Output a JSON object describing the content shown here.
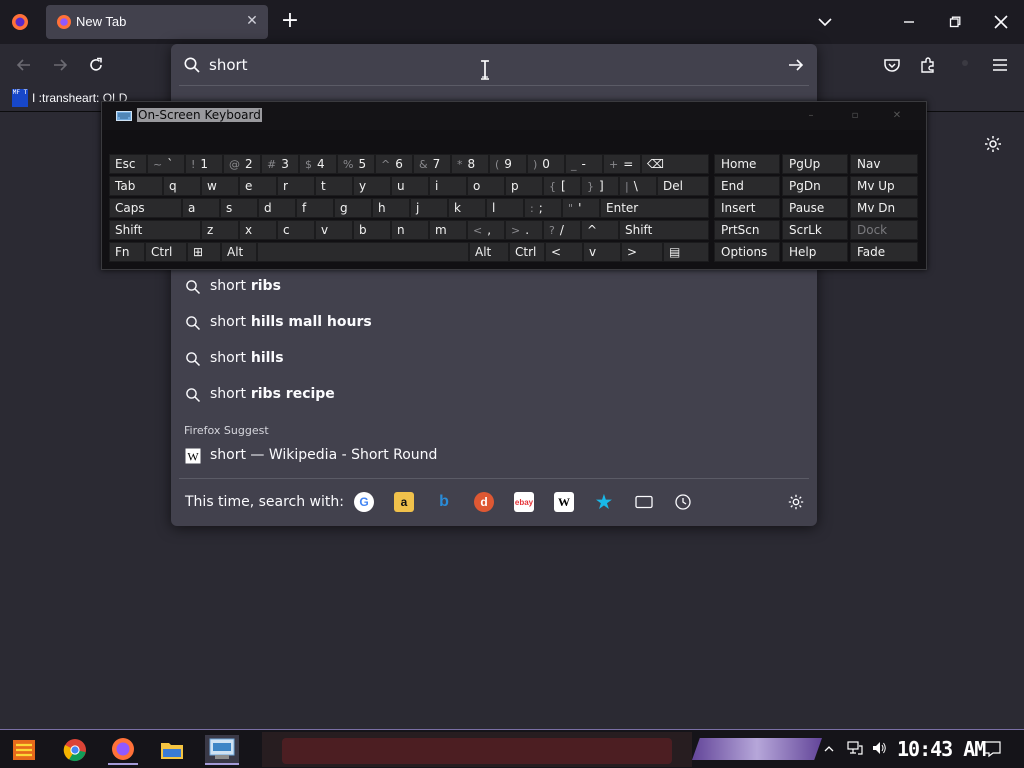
{
  "tab": {
    "title": "New Tab"
  },
  "bookmarks": {
    "item_label": "I :transheart: OLD",
    "item_icon_text": "MF T"
  },
  "urlbar": {
    "value": "short",
    "placeholder": ""
  },
  "suggestions": [
    {
      "prefix": "short",
      "bold": " ribs"
    },
    {
      "prefix": "short",
      "bold": " hills mall hours"
    },
    {
      "prefix": "short",
      "bold": " hills"
    },
    {
      "prefix": "short",
      "bold": " ribs recipe"
    }
  ],
  "firefox_suggest": {
    "header": "Firefox Suggest",
    "item": "short — Wikipedia - Short Round"
  },
  "oneoff": {
    "label": "This time, search with:",
    "engines": [
      "google",
      "amazon",
      "bing",
      "duckduckgo",
      "ebay",
      "wikipedia",
      "bookmarks",
      "tabs",
      "history"
    ]
  },
  "osk": {
    "title": "On-Screen Keyboard",
    "row1": [
      {
        "s": "",
        "m": "Esc"
      },
      {
        "s": "~",
        "m": "`"
      },
      {
        "s": "!",
        "m": "1"
      },
      {
        "s": "@",
        "m": "2"
      },
      {
        "s": "#",
        "m": "3"
      },
      {
        "s": "$",
        "m": "4"
      },
      {
        "s": "%",
        "m": "5"
      },
      {
        "s": "^",
        "m": "6"
      },
      {
        "s": "&",
        "m": "7"
      },
      {
        "s": "*",
        "m": "8"
      },
      {
        "s": "(",
        "m": "9"
      },
      {
        "s": ")",
        "m": "0"
      },
      {
        "s": "_",
        "m": "-"
      },
      {
        "s": "+",
        "m": "="
      },
      {
        "s": "",
        "m": "⌫"
      }
    ],
    "row2": [
      {
        "s": "",
        "m": "Tab"
      },
      {
        "s": "",
        "m": "q"
      },
      {
        "s": "",
        "m": "w"
      },
      {
        "s": "",
        "m": "e"
      },
      {
        "s": "",
        "m": "r"
      },
      {
        "s": "",
        "m": "t"
      },
      {
        "s": "",
        "m": "y"
      },
      {
        "s": "",
        "m": "u"
      },
      {
        "s": "",
        "m": "i"
      },
      {
        "s": "",
        "m": "o"
      },
      {
        "s": "",
        "m": "p"
      },
      {
        "s": "{",
        "m": "["
      },
      {
        "s": "}",
        "m": "]"
      },
      {
        "s": "|",
        "m": "\\"
      },
      {
        "s": "",
        "m": "Del"
      }
    ],
    "row3": [
      {
        "s": "",
        "m": "Caps"
      },
      {
        "s": "",
        "m": "a"
      },
      {
        "s": "",
        "m": "s"
      },
      {
        "s": "",
        "m": "d"
      },
      {
        "s": "",
        "m": "f"
      },
      {
        "s": "",
        "m": "g"
      },
      {
        "s": "",
        "m": "h"
      },
      {
        "s": "",
        "m": "j"
      },
      {
        "s": "",
        "m": "k"
      },
      {
        "s": "",
        "m": "l"
      },
      {
        "s": ":",
        "m": ";"
      },
      {
        "s": "\"",
        "m": "'"
      },
      {
        "s": "",
        "m": "Enter"
      }
    ],
    "row4": [
      {
        "s": "",
        "m": "Shift"
      },
      {
        "s": "",
        "m": "z"
      },
      {
        "s": "",
        "m": "x"
      },
      {
        "s": "",
        "m": "c"
      },
      {
        "s": "",
        "m": "v"
      },
      {
        "s": "",
        "m": "b"
      },
      {
        "s": "",
        "m": "n"
      },
      {
        "s": "",
        "m": "m"
      },
      {
        "s": "<",
        "m": ","
      },
      {
        "s": ">",
        "m": "."
      },
      {
        "s": "?",
        "m": "/"
      },
      {
        "s": "",
        "m": "^"
      },
      {
        "s": "",
        "m": "Shift"
      }
    ],
    "row5": [
      {
        "s": "",
        "m": "Fn"
      },
      {
        "s": "",
        "m": "Ctrl"
      },
      {
        "s": "",
        "m": "⊞"
      },
      {
        "s": "",
        "m": "Alt"
      },
      {
        "s": "",
        "m": ""
      },
      {
        "s": "",
        "m": "Alt"
      },
      {
        "s": "",
        "m": "Ctrl"
      },
      {
        "s": "",
        "m": "<"
      },
      {
        "s": "",
        "m": "v"
      },
      {
        "s": "",
        "m": ">"
      },
      {
        "s": "",
        "m": "▤"
      }
    ],
    "nav_keys": [
      [
        "Home",
        "PgUp",
        "Nav"
      ],
      [
        "End",
        "PgDn",
        "Mv Up"
      ],
      [
        "Insert",
        "Pause",
        "Mv Dn"
      ],
      [
        "PrtScn",
        "ScrLk",
        "Dock"
      ],
      [
        "Options",
        "Help",
        "Fade"
      ]
    ]
  },
  "taskbar": {
    "clock": "10:43 AM"
  },
  "colors": {
    "accent": "#a49bd8",
    "panel": "#42414d",
    "bg": "#2b2a33"
  }
}
